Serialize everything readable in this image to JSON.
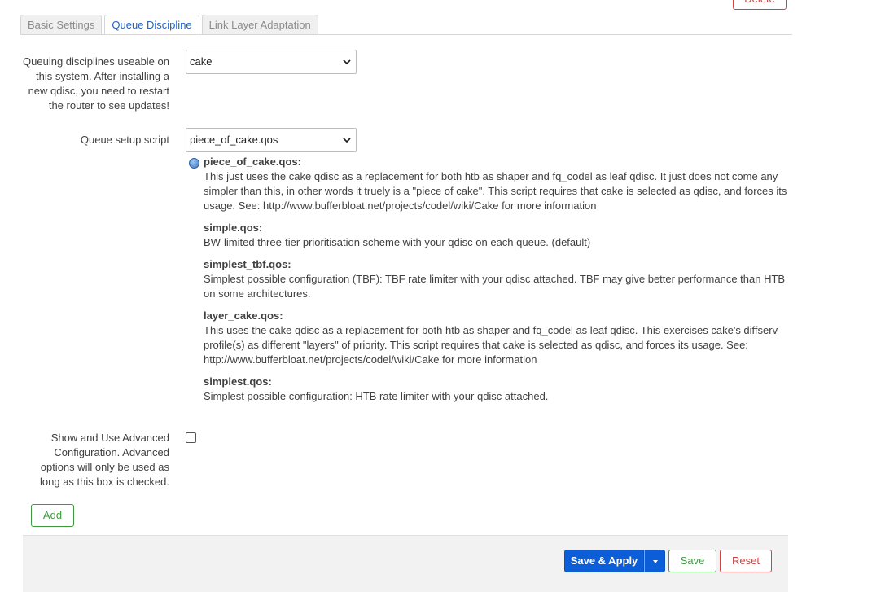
{
  "top": {
    "delete_label": "Delete"
  },
  "tabs": [
    {
      "label": "Basic Settings",
      "active": false
    },
    {
      "label": "Queue Discipline",
      "active": true
    },
    {
      "label": "Link Layer Adaptation",
      "active": false
    }
  ],
  "qdisc": {
    "label_lines": [
      "Queuing disciplines useable on",
      "this system. After installing a",
      "new qdisc, you need to restart",
      "the router to see updates!"
    ],
    "value": "cake"
  },
  "script": {
    "label": "Queue setup script",
    "value": "piece_of_cake.qos"
  },
  "help": [
    {
      "title": "piece_of_cake.qos:",
      "lines": [
        "This just uses the cake qdisc as a replacement for both htb as shaper and fq_codel as leaf qdisc. It just does not come any",
        "simpler than this, in other words it truely is a \"piece of cake\". This script requires that cake is selected as qdisc, and forces its",
        "usage. See: http://www.bufferbloat.net/projects/codel/wiki/Cake for more information"
      ]
    },
    {
      "title": "simple.qos:",
      "lines": [
        "BW-limited three-tier prioritisation scheme with your qdisc on each queue. (default)"
      ]
    },
    {
      "title": "simplest_tbf.qos:",
      "lines": [
        "Simplest possible configuration (TBF): TBF rate limiter with your qdisc attached. TBF may give better performance than HTB",
        "on some architectures."
      ]
    },
    {
      "title": "layer_cake.qos:",
      "lines": [
        "This uses the cake qdisc as a replacement for both htb as shaper and fq_codel as leaf qdisc. This exercises cake's diffserv",
        "profile(s) as different \"layers\" of priority. This script requires that cake is selected as qdisc, and forces its usage. See:",
        "http://www.bufferbloat.net/projects/codel/wiki/Cake for more information"
      ]
    },
    {
      "title": "simplest.qos:",
      "lines": [
        "Simplest possible configuration: HTB rate limiter with your qdisc attached."
      ]
    }
  ],
  "advanced": {
    "label_lines": [
      "Show and Use Advanced",
      "Configuration. Advanced",
      "options will only be used as",
      "long as this box is checked."
    ],
    "checked": false
  },
  "buttons": {
    "add": "Add",
    "save_apply": "Save & Apply",
    "save": "Save",
    "reset": "Reset"
  },
  "colors": {
    "primary": "#0b5ed7",
    "positive": "#3f9a3f",
    "negative": "#cc4444",
    "tab_active": "#2163c8"
  }
}
